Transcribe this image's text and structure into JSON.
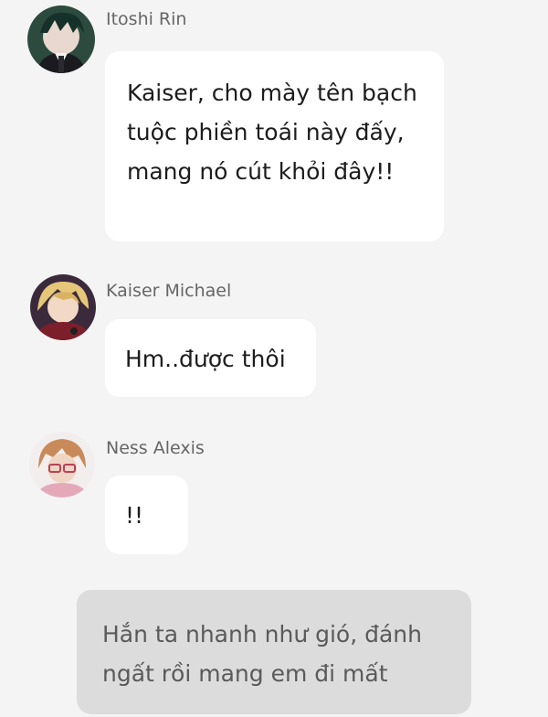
{
  "messages": [
    {
      "sender": "Itoshi Rin",
      "avatar_icon": "itoshi-rin-avatar",
      "text": "Kaiser, cho mày tên bạch tuộc phiền toái này đấy, mang nó cút khỏi đây!!"
    },
    {
      "sender": "Kaiser Michael",
      "avatar_icon": "kaiser-michael-avatar",
      "text": "Hm..được thôi"
    },
    {
      "sender": "Ness Alexis",
      "avatar_icon": "ness-alexis-avatar",
      "text": "!!"
    }
  ],
  "narration": {
    "text": "Hắn ta nhanh như gió, đánh ngất rồi mang em đi mất"
  },
  "colors": {
    "background": "#f4f4f4",
    "bubble": "#ffffff",
    "narration_bubble": "#dcdcdc",
    "sender_text": "#666666",
    "message_text": "#1c1c1c",
    "narration_text": "#5a5a5a"
  }
}
